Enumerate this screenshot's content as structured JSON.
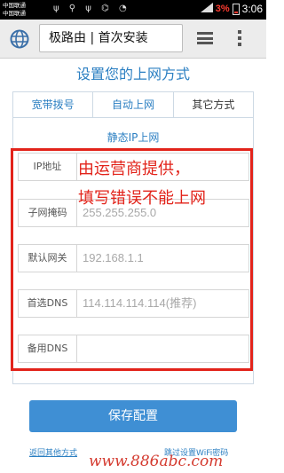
{
  "status_bar": {
    "carrier_1": "中国联通",
    "carrier_2": "中国联通",
    "icons": "ψ ⚲ ψ ⌬ ◔",
    "battery_percent": "3%",
    "time": "3:06"
  },
  "browser": {
    "url_text": "极路由 | 首次安装"
  },
  "page": {
    "title": "设置您的上网方式",
    "tabs": [
      {
        "label": "宽带拨号",
        "active": false
      },
      {
        "label": "自动上网",
        "active": false
      },
      {
        "label": "其它方式",
        "active": true
      }
    ],
    "section_title": "静态IP上网",
    "fields": [
      {
        "label": "IP地址",
        "value": ""
      },
      {
        "label": "子网掩码",
        "value": "255.255.255.0"
      },
      {
        "label": "默认网关",
        "value": "192.168.1.1"
      },
      {
        "label": "首选DNS",
        "value": "114.114.114.114(推荐)"
      },
      {
        "label": "备用DNS",
        "value": ""
      }
    ],
    "annotation_line_1": "由运营商提供，",
    "annotation_line_2": "填写错误不能上网",
    "save_button": "保存配置",
    "back_link": "返回其他方式",
    "skip_link": "跳过设置WiFi密码"
  },
  "watermark": "www.886abc.com",
  "colors": {
    "accent": "#3f8fd4",
    "link": "#2b7fc2",
    "annotation_red": "#e2231a"
  }
}
